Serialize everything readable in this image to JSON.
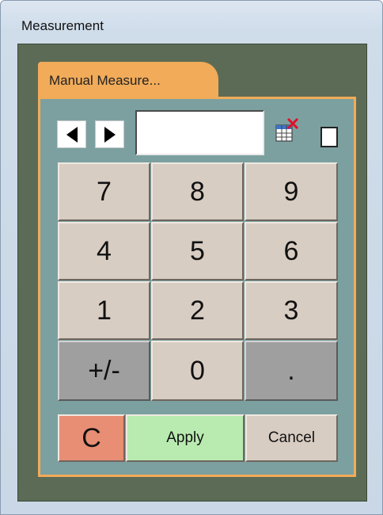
{
  "window": {
    "title": "Measurement"
  },
  "tab": {
    "label": "Manual Measure..."
  },
  "entry": {
    "value": ""
  },
  "navigation": {
    "prev_icon": "triangle-left",
    "next_icon": "triangle-right"
  },
  "tools": {
    "clear_table_icon": "table-clear",
    "checkbox_checked": false
  },
  "keypad": {
    "rows": [
      [
        "7",
        "8",
        "9"
      ],
      [
        "4",
        "5",
        "6"
      ],
      [
        "1",
        "2",
        "3"
      ],
      [
        "+/-",
        "0",
        "."
      ]
    ]
  },
  "actions": {
    "clear_label": "C",
    "apply_label": "Apply",
    "cancel_label": "Cancel"
  },
  "colors": {
    "frame": "#5c6b55",
    "panel": "#7ca0a0",
    "tab": "#f1ab59",
    "key": "#d8cdc2",
    "key_gray": "#9f9f9f",
    "clear": "#e88e74",
    "apply": "#b9ebb1"
  }
}
